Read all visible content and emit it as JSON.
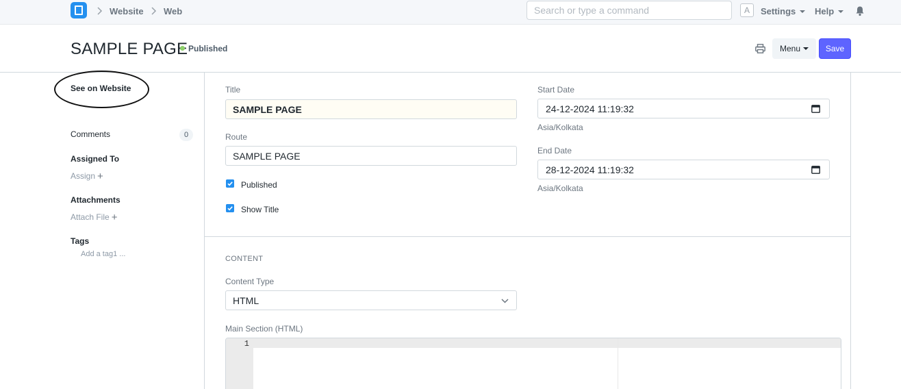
{
  "navbar": {
    "breadcrumbs": [
      "Website",
      "Web"
    ],
    "search_placeholder": "Search or type a command",
    "avatar_letter": "A",
    "settings_label": "Settings",
    "help_label": "Help"
  },
  "page": {
    "title": "SAMPLE PAGE",
    "status": "Published",
    "menu_label": "Menu",
    "save_label": "Save"
  },
  "sidebar": {
    "see_on_website": "See on Website",
    "comments_label": "Comments",
    "comments_count": "0",
    "assigned_to_label": "Assigned To",
    "assign_label": "Assign",
    "attachments_label": "Attachments",
    "attach_file_label": "Attach File",
    "tags_label": "Tags",
    "add_tag_label": "Add a tag1 ..."
  },
  "form": {
    "title_label": "Title",
    "title_value": "SAMPLE PAGE",
    "route_label": "Route",
    "route_value": "SAMPLE PAGE",
    "published_label": "Published",
    "show_title_label": "Show Title",
    "start_date_label": "Start Date",
    "start_date_value": "24-12-2024 11:19:32",
    "start_tz": "Asia/Kolkata",
    "end_date_label": "End Date",
    "end_date_value": "28-12-2024 11:19:32",
    "end_tz": "Asia/Kolkata",
    "content_section": "CONTENT",
    "content_type_label": "Content Type",
    "content_type_value": "HTML",
    "main_section_label": "Main Section (HTML)",
    "editor_line_number": "1"
  },
  "colors": {
    "primary_button": "#5e64ff",
    "status_dot": "#8dd06a",
    "checkbox": "#2490ef",
    "logo": "#2490ef"
  },
  "icons": [
    "app-logo-icon",
    "chevron-right-icon",
    "caret-down-icon",
    "bell-icon",
    "printer-icon",
    "plus-icon",
    "calendar-icon",
    "checkbox-checked-icon",
    "chevron-down-icon"
  ]
}
